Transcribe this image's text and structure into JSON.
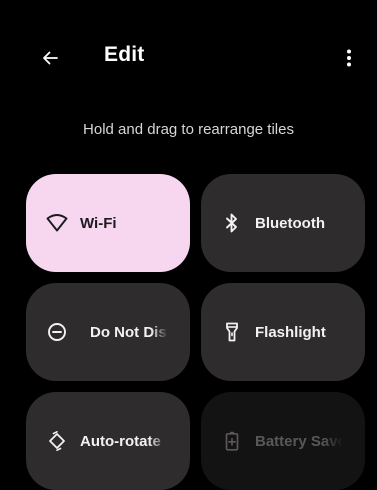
{
  "toolbar": {
    "title": "Edit",
    "back_icon": "arrow-left-icon",
    "menu_icon": "more-vert-icon"
  },
  "hint": "Hold and drag to rearrange tiles",
  "colors": {
    "background": "#000000",
    "tile": "#2e2c2c",
    "tile_active": "#f7d6ef",
    "tile_disabled": "#141313"
  },
  "tiles": [
    {
      "label": "Wi-Fi",
      "icon": "wifi-icon",
      "state": "active"
    },
    {
      "label": "Bluetooth",
      "icon": "bluetooth-icon",
      "state": "inactive"
    },
    {
      "label": "Do Not Disturb",
      "icon": "do-not-disturb-icon",
      "state": "inactive"
    },
    {
      "label": "Flashlight",
      "icon": "flashlight-icon",
      "state": "inactive"
    },
    {
      "label": "Auto-rotate",
      "icon": "auto-rotate-icon",
      "state": "inactive"
    },
    {
      "label": "Battery Saver",
      "icon": "battery-saver-icon",
      "state": "disabled"
    }
  ]
}
